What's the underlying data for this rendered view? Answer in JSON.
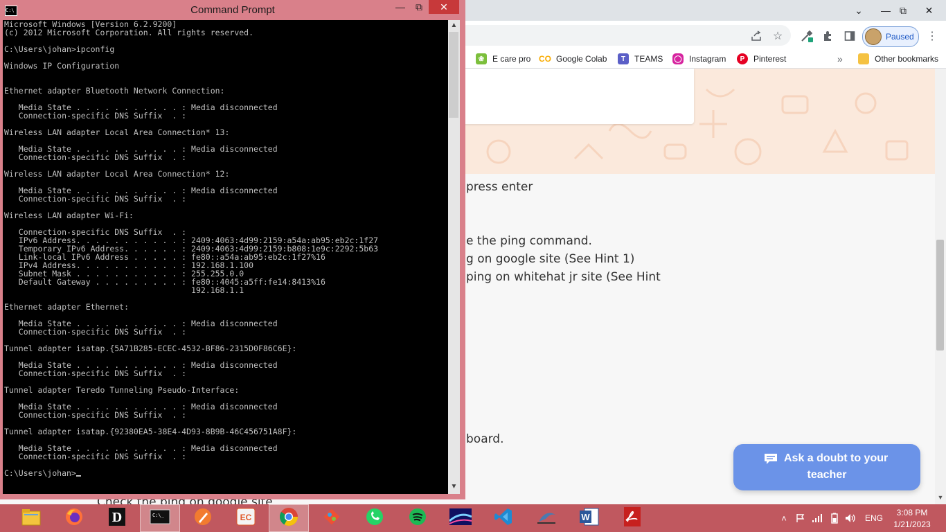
{
  "browser": {
    "profile_label": "Paused",
    "bookmarks": [
      {
        "label": "E care pro",
        "icon": "leaf-icon"
      },
      {
        "label": "Google Colab",
        "icon": "colab-icon"
      },
      {
        "label": "TEAMS",
        "icon": "teams-icon"
      },
      {
        "label": "Instagram",
        "icon": "instagram-icon"
      },
      {
        "label": "Pinterest",
        "icon": "pinterest-icon"
      }
    ],
    "bookmarks_overflow": "»",
    "other_bookmarks": "Other bookmarks"
  },
  "page": {
    "lines": [
      "press enter",
      "e the ping command.",
      "g on google site (See Hint 1)",
      "ping on whitehat jr site (See Hint",
      "board.",
      "Check the ping on google site"
    ],
    "ask_doubt": {
      "line1": "Ask a doubt to your",
      "line2": "teacher"
    }
  },
  "cmd": {
    "title": "Command Prompt",
    "lines": [
      "Microsoft Windows [Version 6.2.9200]",
      "(c) 2012 Microsoft Corporation. All rights reserved.",
      "",
      "C:\\Users\\johan>ipconfig",
      "",
      "Windows IP Configuration",
      "",
      "",
      "Ethernet adapter Bluetooth Network Connection:",
      "",
      "   Media State . . . . . . . . . . . : Media disconnected",
      "   Connection-specific DNS Suffix  . :",
      "",
      "Wireless LAN adapter Local Area Connection* 13:",
      "",
      "   Media State . . . . . . . . . . . : Media disconnected",
      "   Connection-specific DNS Suffix  . :",
      "",
      "Wireless LAN adapter Local Area Connection* 12:",
      "",
      "   Media State . . . . . . . . . . . : Media disconnected",
      "   Connection-specific DNS Suffix  . :",
      "",
      "Wireless LAN adapter Wi-Fi:",
      "",
      "   Connection-specific DNS Suffix  . :",
      "   IPv6 Address. . . . . . . . . . . : 2409:4063:4d99:2159:a54a:ab95:eb2c:1f27",
      "   Temporary IPv6 Address. . . . . . : 2409:4063:4d99:2159:b808:1e9c:2292:5b63",
      "   Link-local IPv6 Address . . . . . : fe80::a54a:ab95:eb2c:1f27%16",
      "   IPv4 Address. . . . . . . . . . . : 192.168.1.100",
      "   Subnet Mask . . . . . . . . . . . : 255.255.0.0",
      "   Default Gateway . . . . . . . . . : fe80::4045:a5ff:fe14:8413%16",
      "                                       192.168.1.1",
      "",
      "Ethernet adapter Ethernet:",
      "",
      "   Media State . . . . . . . . . . . : Media disconnected",
      "   Connection-specific DNS Suffix  . :",
      "",
      "Tunnel adapter isatap.{5A71B285-ECEC-4532-BF86-2315D0F86C6E}:",
      "",
      "   Media State . . . . . . . . . . . : Media disconnected",
      "   Connection-specific DNS Suffix  . :",
      "",
      "Tunnel adapter Teredo Tunneling Pseudo-Interface:",
      "",
      "   Media State . . . . . . . . . . . : Media disconnected",
      "   Connection-specific DNS Suffix  . :",
      "",
      "Tunnel adapter isatap.{92380EA5-38E4-4D93-8B9B-46C456751A8F}:",
      "",
      "   Media State . . . . . . . . . . . : Media disconnected",
      "   Connection-specific DNS Suffix  . :",
      ""
    ],
    "prompt": "C:\\Users\\johan>"
  },
  "taskbar": {
    "apps": [
      {
        "name": "file-explorer-icon"
      },
      {
        "name": "firefox-icon"
      },
      {
        "name": "d-app-icon",
        "glyph": "D"
      },
      {
        "name": "command-prompt-icon",
        "glyph": "C:\\_",
        "active": true
      },
      {
        "name": "paint-brush-icon"
      },
      {
        "name": "ec-app-icon",
        "glyph": "EC"
      },
      {
        "name": "chrome-icon",
        "active": true
      },
      {
        "name": "git-icon"
      },
      {
        "name": "whatsapp-icon"
      },
      {
        "name": "spotify-icon"
      },
      {
        "name": "media-app-icon"
      },
      {
        "name": "vscode-icon"
      },
      {
        "name": "wireshark-icon"
      },
      {
        "name": "word-icon",
        "glyph": "W"
      },
      {
        "name": "acrobat-icon"
      }
    ],
    "language": "ENG",
    "time": "3:08 PM",
    "date": "1/21/2023"
  }
}
